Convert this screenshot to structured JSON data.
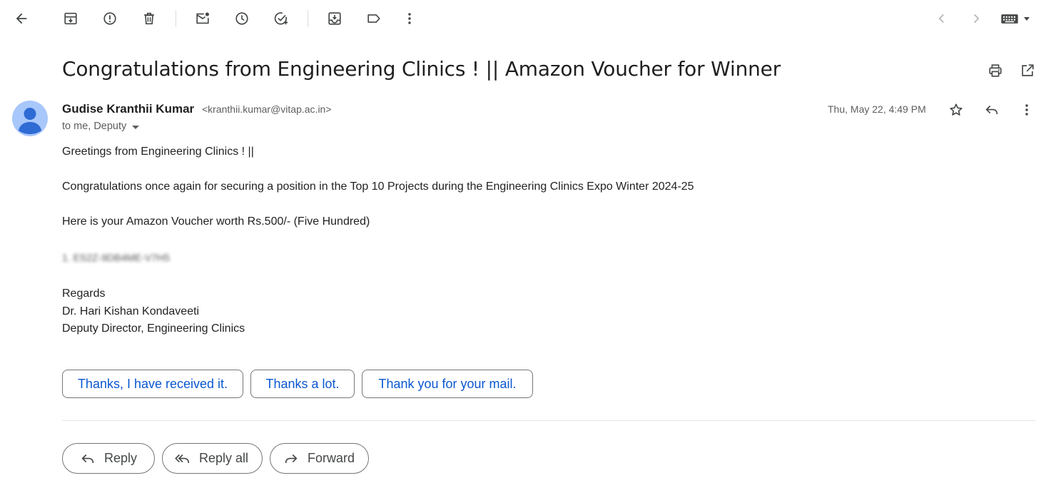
{
  "toolbar": {
    "icons": [
      "back-arrow-icon",
      "archive-icon",
      "report-spam-icon",
      "delete-icon",
      "mark-unread-icon",
      "snooze-icon",
      "add-to-tasks-icon",
      "move-to-icon",
      "label-icon",
      "more-vert-icon",
      "chevron-left-icon",
      "chevron-right-icon",
      "keyboard-icon"
    ]
  },
  "email": {
    "subject": "Congratulations from Engineering Clinics ! || Amazon Voucher for Winner",
    "sender_name": "Gudise Kranthii Kumar",
    "sender_email": "<kranthii.kumar@vitap.ac.in>",
    "recipients": "to me, Deputy",
    "date": "Thu, May 22, 4:49 PM",
    "avatar_color": "#a8c7fa",
    "body": {
      "greeting": "Greetings from Engineering Clinics ! ||",
      "line1": "Congratulations once again for securing a position in the Top 10 Projects during the Engineering Clinics Expo Winter 2024-25",
      "line2": "Here is your Amazon Voucher worth Rs.500/- (Five Hundred)",
      "voucher": "1. ES2Z-9DB4ME-V7H5",
      "regards": "Regards",
      "signature_name": "Dr. Hari Kishan Kondaveeti",
      "signature_title": "Deputy Director, Engineering Clinics"
    }
  },
  "smart_replies": [
    "Thanks, I have received it.",
    "Thanks a lot.",
    "Thank you for your mail."
  ],
  "actions": {
    "reply": "Reply",
    "reply_all": "Reply all",
    "forward": "Forward"
  },
  "colors": {
    "accent_blue": "#0b57d0",
    "icon_gray": "#444746"
  }
}
